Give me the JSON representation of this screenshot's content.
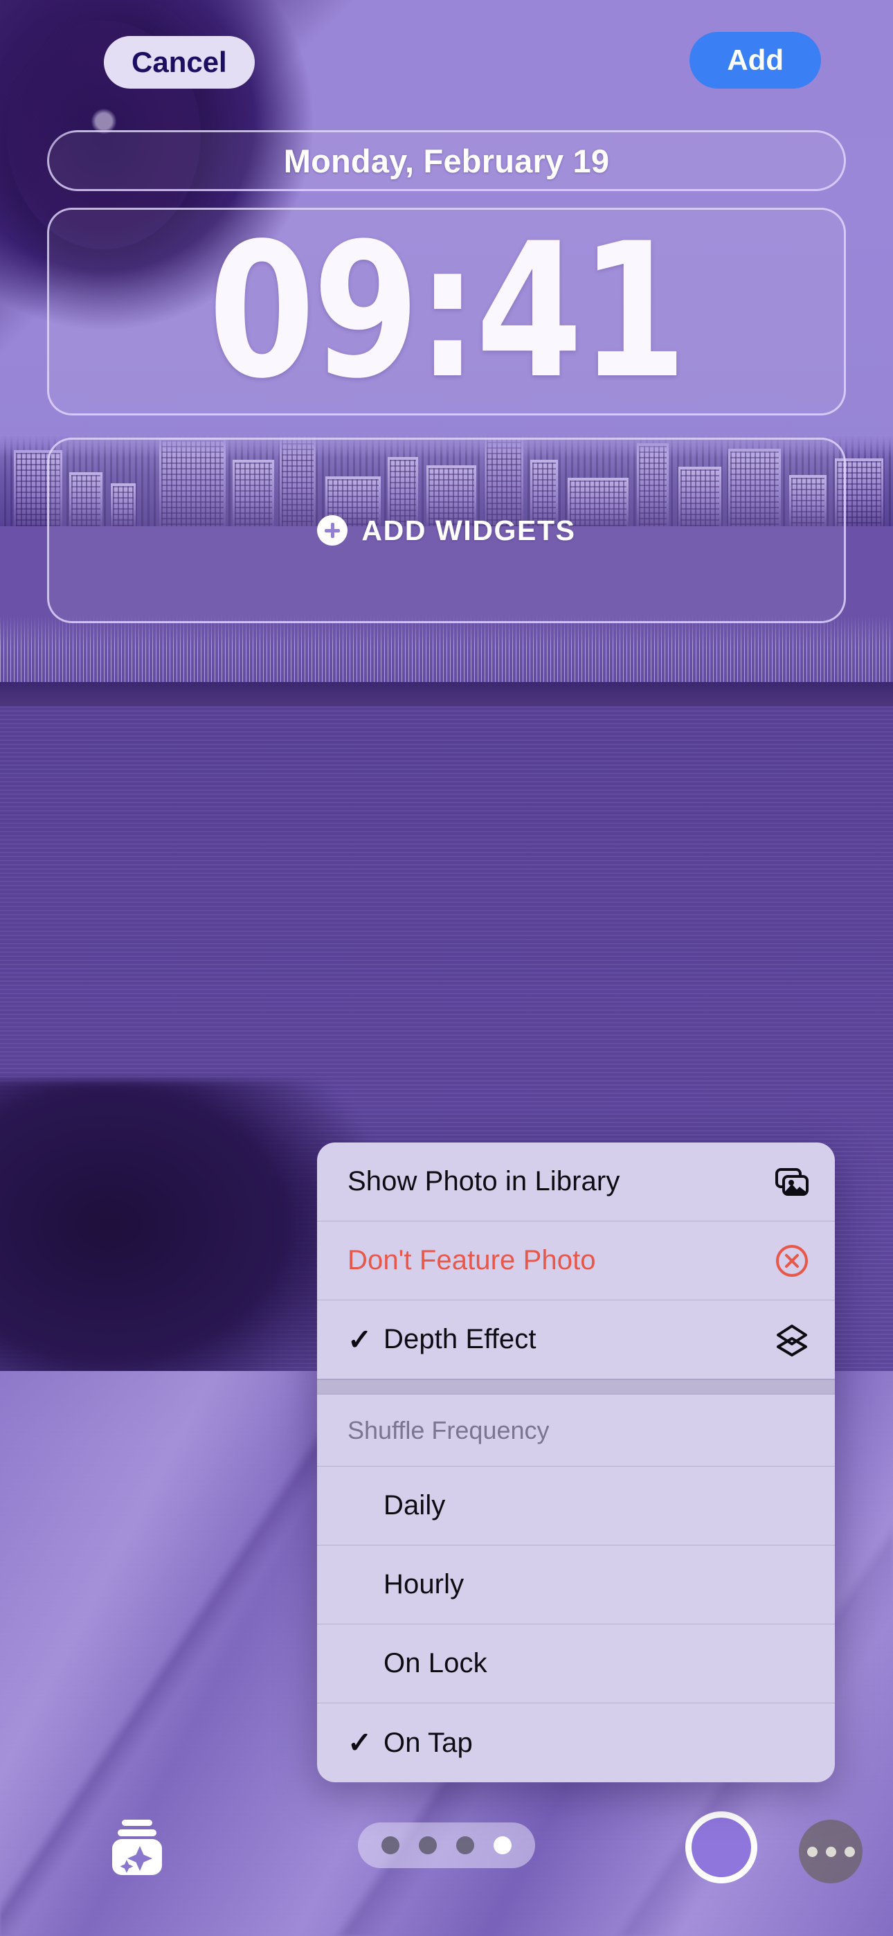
{
  "top_bar": {
    "cancel_label": "Cancel",
    "add_label": "Add",
    "add_button_color": "#3B7FF5",
    "cancel_bg_color": "#E4DEF4",
    "cancel_text_color": "#1B0E63"
  },
  "lock_screen": {
    "date": "Monday, February 19",
    "time": "09:41",
    "add_widgets_label": "ADD WIDGETS"
  },
  "context_menu": {
    "items": [
      {
        "label": "Show Photo in Library",
        "icon": "photo-stack-icon",
        "checked": false,
        "destructive": false
      },
      {
        "label": "Don't Feature Photo",
        "icon": "x-circle-icon",
        "checked": false,
        "destructive": true
      },
      {
        "label": "Depth Effect",
        "icon": "layers-icon",
        "checked": true,
        "destructive": false
      }
    ],
    "section_header": "Shuffle Frequency",
    "frequency_options": [
      {
        "label": "Daily",
        "checked": false
      },
      {
        "label": "Hourly",
        "checked": false
      },
      {
        "label": "On Lock",
        "checked": false
      },
      {
        "label": "On Tap",
        "checked": true
      }
    ],
    "checkmark_glyph": "✓",
    "background_color": "#D6CFEC",
    "destructive_color": "#E8584A",
    "header_text_color": "#7B7590"
  },
  "bottom_bar": {
    "filter_icon": "photo-shuffle-sparkle-icon",
    "page_dots": {
      "count": 4,
      "active_index": 3
    },
    "color_swatch_color": "#8F76DC",
    "more_icon": "ellipsis-icon"
  }
}
